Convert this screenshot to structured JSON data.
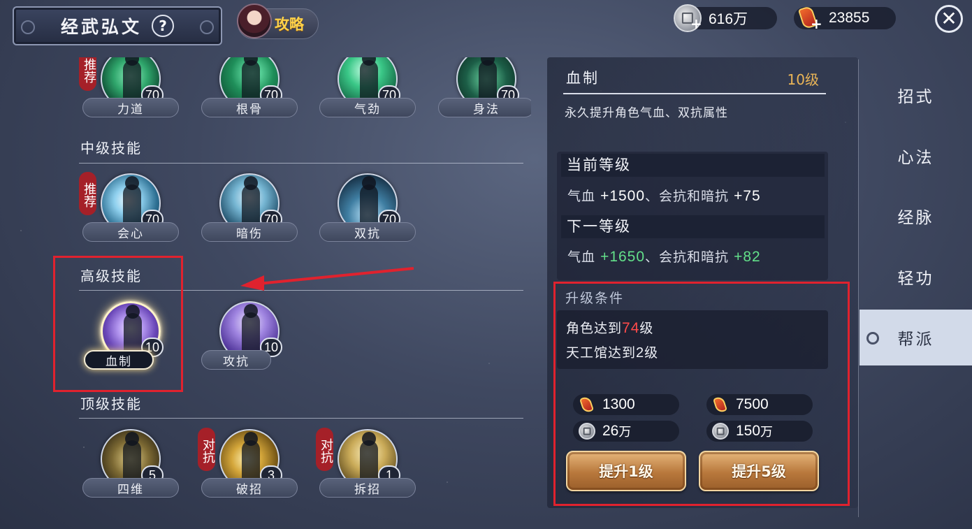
{
  "header": {
    "title": "经武弘文",
    "help_label": "?",
    "guide_label": "攻略",
    "currencies": [
      {
        "icon": "silver-coin-icon",
        "value": "616万"
      },
      {
        "icon": "red-token-icon",
        "value": "23855"
      }
    ],
    "close_label": "✕"
  },
  "sections": [
    {
      "title": "中级技能"
    },
    {
      "title": "高级技能"
    },
    {
      "title": "顶级技能"
    }
  ],
  "skills": {
    "basic": [
      {
        "name": "力道",
        "level": "70",
        "tag": "推荐"
      },
      {
        "name": "根骨",
        "level": "70"
      },
      {
        "name": "气劲",
        "level": "70"
      },
      {
        "name": "身法",
        "level": "70"
      }
    ],
    "mid": [
      {
        "name": "会心",
        "level": "70",
        "tag": "推荐"
      },
      {
        "name": "暗伤",
        "level": "70"
      },
      {
        "name": "双抗",
        "level": "70"
      }
    ],
    "high": [
      {
        "name": "血制",
        "level": "10",
        "selected": true
      },
      {
        "name": "攻抗",
        "level": "10"
      }
    ],
    "top": [
      {
        "name": "四维",
        "level": "5"
      },
      {
        "name": "破招",
        "level": "3",
        "tag": "对抗"
      },
      {
        "name": "拆招",
        "level": "1",
        "tag": "对抗"
      }
    ]
  },
  "detail": {
    "name": "血制",
    "level": "10级",
    "description": "永久提升角色气血、双抗属性",
    "current_header": "当前等级",
    "current": {
      "hp_label": "气血",
      "hp": "+1500",
      "sep": "、会抗和暗抗",
      "res": "+75"
    },
    "next_header": "下一等级",
    "next": {
      "hp_label": "气血",
      "hp": "+1650",
      "sep": "、会抗和暗抗",
      "res": "+82"
    },
    "requirement_title": "升级条件",
    "requirements": [
      {
        "prefix": "角色达到",
        "value": "74",
        "suffix": "级"
      },
      {
        "prefix": "天工馆达到",
        "value": "2",
        "suffix": "级"
      }
    ],
    "costs": [
      {
        "icon": "red-token-icon",
        "value": "1300",
        "unit": ""
      },
      {
        "icon": "red-token-icon",
        "value": "7500",
        "unit": ""
      },
      {
        "icon": "silver-coin-icon",
        "value": "26",
        "unit": "万"
      },
      {
        "icon": "silver-coin-icon",
        "value": "150",
        "unit": "万"
      }
    ],
    "upgrade_1": "提升1级",
    "upgrade_5": "提升5级"
  },
  "nav": {
    "items": [
      {
        "label": "招式"
      },
      {
        "label": "心法"
      },
      {
        "label": "经脉"
      },
      {
        "label": "轻功"
      },
      {
        "label": "帮派",
        "active": true
      }
    ]
  },
  "colors": {
    "accent_gold": "#eab557",
    "highlight_red": "#ff4a4a",
    "bonus_green": "#63e08a",
    "annotation_red": "#e0222e"
  }
}
